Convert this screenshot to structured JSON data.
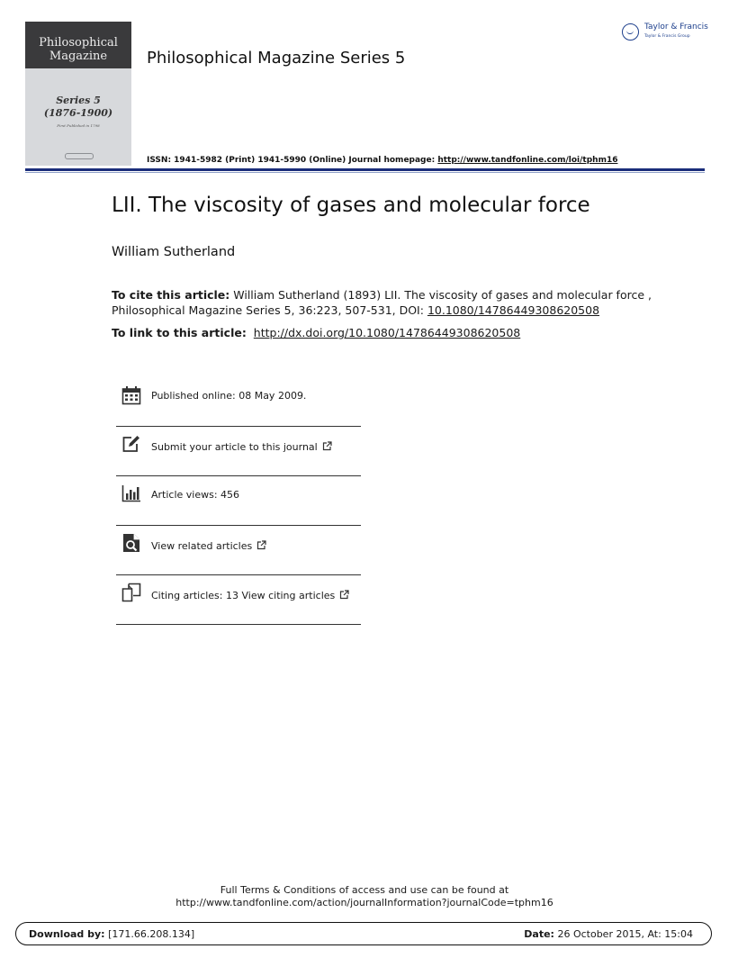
{
  "cover": {
    "title_line1": "Philosophical",
    "title_line2": "Magazine",
    "series": "Series 5",
    "years": "(1876-1900)",
    "smallprint": "First Published in 1798"
  },
  "journal_title": "Philosophical Magazine Series 5",
  "publisher": {
    "name": "Taylor & Francis",
    "group": "Taylor & Francis Group"
  },
  "issn": {
    "text": "ISSN: 1941-5982 (Print) 1941-5990 (Online) Journal homepage: ",
    "url": "http://www.tandfonline.com/loi/tphm16"
  },
  "article": {
    "title": "LII. The viscosity of gases and molecular force",
    "author": "William Sutherland"
  },
  "cite": {
    "label": "To cite this article:",
    "line1": " William Sutherland (1893) LII. The viscosity of gases and molecular force ,",
    "line2": "Philosophical Magazine Series 5, 36:223, 507-531, DOI: ",
    "doi": "10.1080/14786449308620508"
  },
  "link": {
    "label": "To link to this article:",
    "url": "http://dx.doi.org/10.1080/14786449308620508"
  },
  "info": {
    "published": "Published online: 08 May 2009.",
    "submit": "Submit your article to this journal",
    "views": "Article views: 456",
    "related": "View related articles",
    "citing": "Citing articles: 13 View citing articles"
  },
  "footer": {
    "line1": "Full Terms & Conditions of access and use can be found at",
    "line2": "http://www.tandfonline.com/action/journalInformation?journalCode=tphm16"
  },
  "download": {
    "label": "Download by:",
    "value": " [171.66.208.134]"
  },
  "date": {
    "label": "Date:",
    "value": " 26 October 2015, At: 15:04"
  },
  "colors": {
    "rule": "#1a2d7a",
    "publisher": "#1d3f8c",
    "cover": "#d7d9dc"
  }
}
